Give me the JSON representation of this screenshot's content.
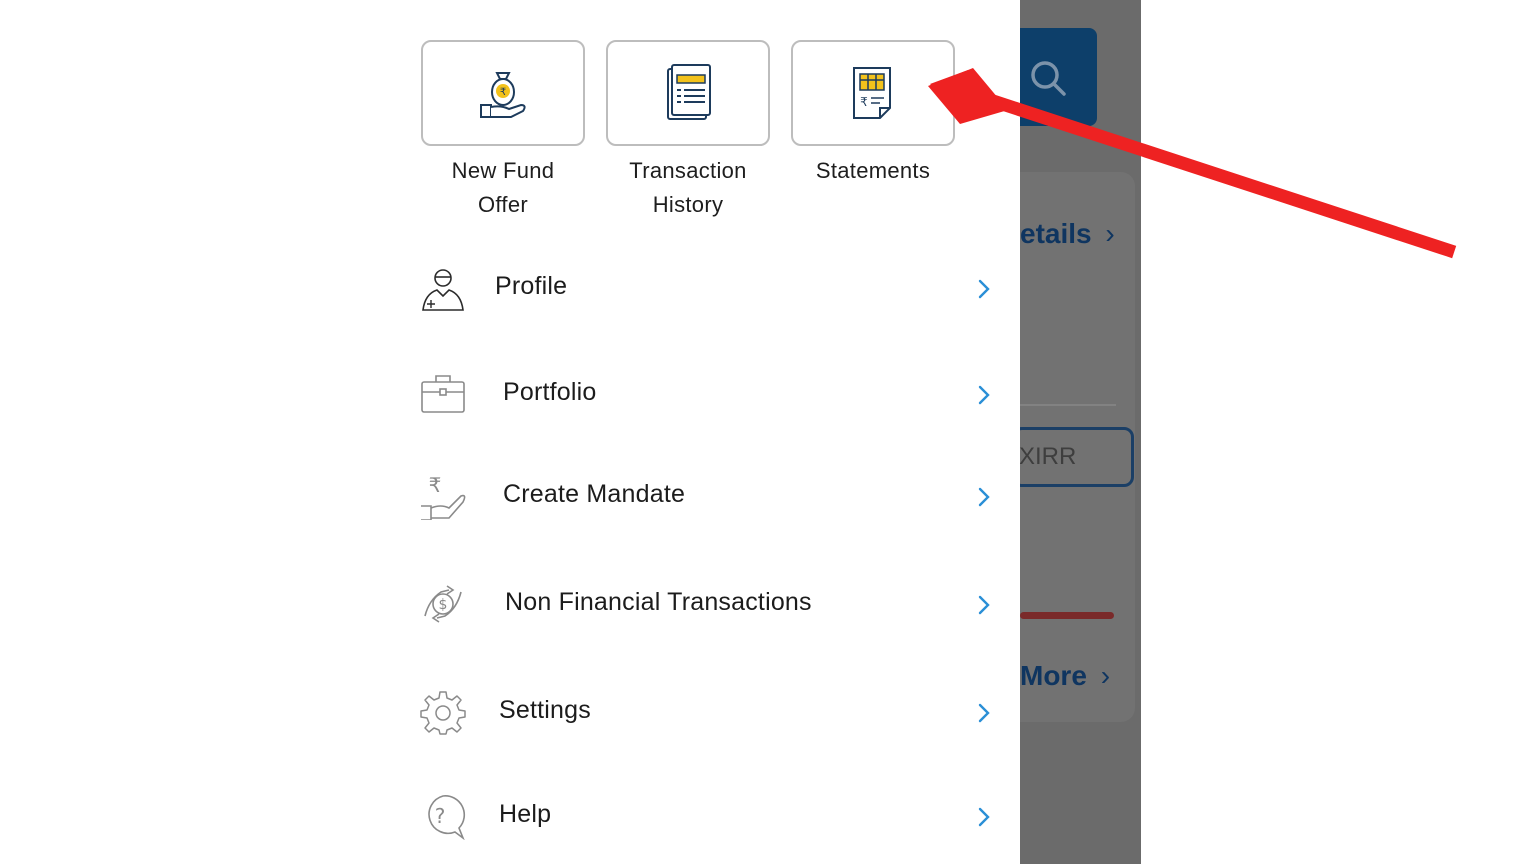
{
  "background": {
    "link_details": "etails",
    "link_more": "More",
    "xirr_label": "XIRR",
    "accent_color": "#0d3f6a"
  },
  "quick_actions": [
    {
      "label": "New Fund\nOffer",
      "icon": "money-bag-hand-icon"
    },
    {
      "label": "Transaction\nHistory",
      "icon": "clipboard-list-icon"
    },
    {
      "label": "Statements",
      "icon": "statement-document-icon"
    }
  ],
  "menu": [
    {
      "label": "Profile",
      "icon": "user-profile-icon"
    },
    {
      "label": "Portfolio",
      "icon": "briefcase-icon"
    },
    {
      "label": "Create Mandate",
      "icon": "rupee-hand-icon"
    },
    {
      "label": "Non Financial Transactions",
      "icon": "money-exchange-icon"
    },
    {
      "label": "Settings",
      "icon": "gear-icon"
    },
    {
      "label": "Help",
      "icon": "help-bubble-icon"
    }
  ],
  "colors": {
    "chevron": "#2a8fd6",
    "annotation_arrow": "#ee2222",
    "icon_yellow": "#f3c21b",
    "icon_navy": "#1d3b5c"
  }
}
